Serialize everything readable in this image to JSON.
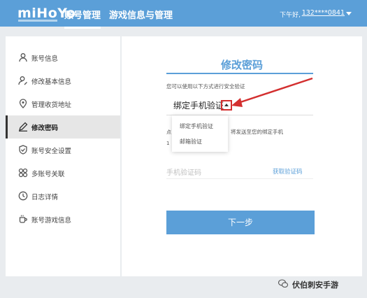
{
  "topbar": {
    "logo": "miHoYo",
    "tabs": [
      {
        "label": "账号管理",
        "active": true
      },
      {
        "label": "游戏信息与管理",
        "active": false
      }
    ],
    "greeting": "下午好,",
    "user": "132****0841",
    "background": "#5b9fd8"
  },
  "sidebar": {
    "items": [
      {
        "label": "账号信息",
        "icon": "user-icon",
        "active": false
      },
      {
        "label": "修改基本信息",
        "icon": "user-edit-icon",
        "active": false
      },
      {
        "label": "管理收货地址",
        "icon": "location-pin-icon",
        "active": false
      },
      {
        "label": "修改密码",
        "icon": "pencil-icon",
        "active": true
      },
      {
        "label": "账号安全设置",
        "icon": "shield-check-icon",
        "active": false
      },
      {
        "label": "多账号关联",
        "icon": "link-accounts-icon",
        "active": false
      },
      {
        "label": "日志详情",
        "icon": "clock-icon",
        "active": false
      },
      {
        "label": "账号游戏信息",
        "icon": "cup-icon",
        "active": false
      }
    ]
  },
  "main": {
    "title": "修改密码",
    "hint": "您可以使用以下方式进行安全验证",
    "method_selected": "绑定手机验证",
    "dropdown_options": [
      "绑定手机验证",
      "邮箱验证"
    ],
    "peek_char_1": "点",
    "peek_char_2": "1",
    "send_text": "将发送至您的绑定手机",
    "code_placeholder": "手机验证码",
    "get_code": "获取验证码",
    "next_button": "下一步"
  },
  "watermark": {
    "text": "伏伯刺安手游"
  },
  "colors": {
    "accent": "#5b9fd8",
    "highlight": "#d32f2f"
  }
}
